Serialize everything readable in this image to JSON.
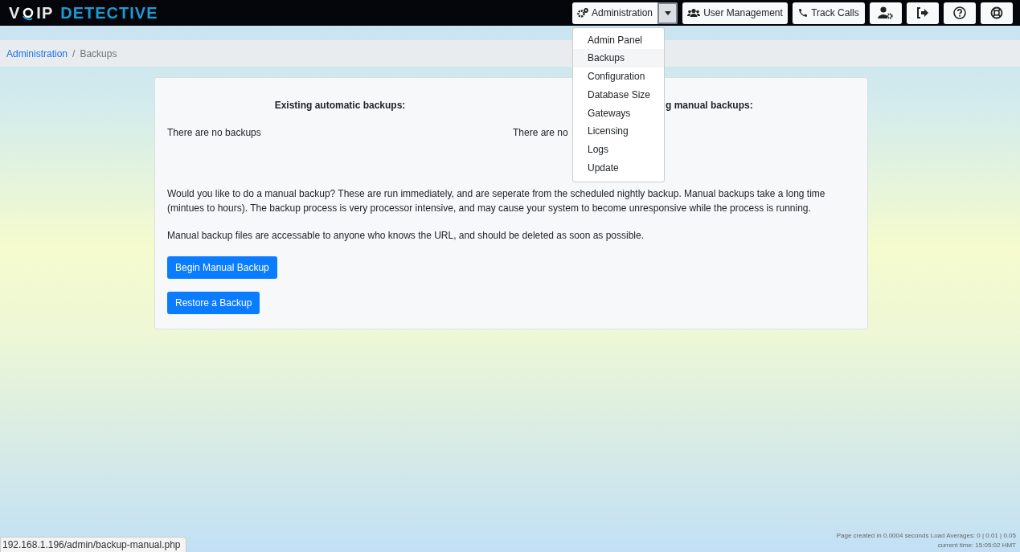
{
  "logo": {
    "first": "V",
    "second": "IP",
    "third": "DETECTIVE"
  },
  "nav": {
    "admin_button": "Administration",
    "buttons": [
      {
        "label": "User Management",
        "kind": "users"
      },
      {
        "label": "Track Calls",
        "kind": "phone"
      }
    ],
    "icon_buttons": [
      {
        "kind": "user-settings"
      },
      {
        "kind": "logout"
      },
      {
        "kind": "help"
      },
      {
        "kind": "support"
      }
    ]
  },
  "dropdown": {
    "expanded": true,
    "items": [
      {
        "label": "Admin Panel",
        "selected": false
      },
      {
        "label": "Backups",
        "selected": true
      },
      {
        "label": "Configuration",
        "selected": false
      },
      {
        "label": "Database Size",
        "selected": false
      },
      {
        "label": "Gateways",
        "selected": false
      },
      {
        "label": "Licensing",
        "selected": false
      },
      {
        "label": "Logs",
        "selected": false
      },
      {
        "label": "Update",
        "selected": false
      }
    ]
  },
  "breadcrumb": {
    "link": "Administration",
    "separator": "/",
    "current": "Backups"
  },
  "card": {
    "left": {
      "heading": "Existing automatic backups:",
      "text": "There are no backups"
    },
    "right": {
      "heading": "g manual backups:",
      "text": "There are no"
    },
    "paragraphs": [
      "Would you like to do a manual backup? These are run immediately, and are seperate from the scheduled nightly backup. Manual backups take a long time (mintues to hours). The backup process is very processor intensive, and may cause your system to become unresponsive while the process is running.",
      "Manual backup files are accessable to anyone who knows the URL, and should be deleted as soon as possible."
    ],
    "buttons": [
      "Begin Manual Backup",
      "Restore a Backup"
    ]
  },
  "footer": {
    "line1": "Page created in 0.0004 seconds Load Averages: 0 | 0.01 | 0.05",
    "line2": "current time: 15:05:02 HMT"
  },
  "status_url": "192.168.1.196/admin/backup-manual.php"
}
